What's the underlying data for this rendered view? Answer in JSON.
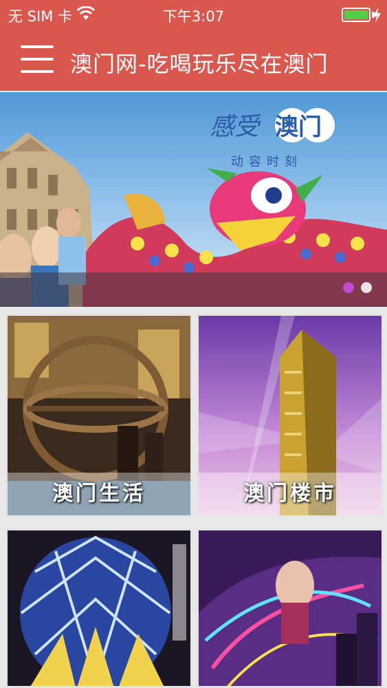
{
  "status": {
    "carrier": "无 SIM 卡",
    "time": "下午3:07",
    "battery_level": 1.0
  },
  "nav": {
    "title": "澳门网-吃喝玩乐尽在澳门",
    "menu_icon": "hamburger-menu-icon"
  },
  "banner": {
    "headline_part1": "感受",
    "headline_part2": "澳门",
    "subtitle": "动容时刻",
    "pages": 2,
    "active_page": 1
  },
  "tiles": [
    {
      "label": "澳门生活"
    },
    {
      "label": "澳门楼市"
    },
    {
      "label": ""
    },
    {
      "label": ""
    }
  ],
  "colors": {
    "nav_bg": "#d9574d",
    "battery": "#52d04a",
    "pager_active": "#c04bd0"
  }
}
